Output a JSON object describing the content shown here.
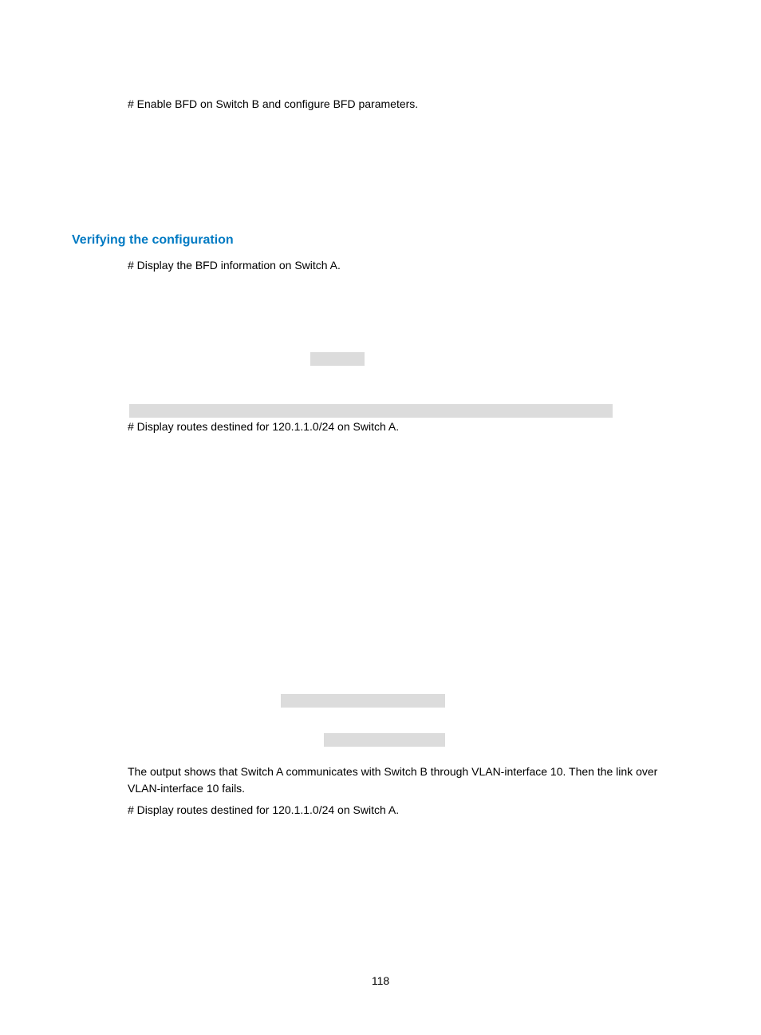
{
  "content": {
    "para1": "# Enable BFD on Switch B and configure BFD parameters.",
    "heading": "Verifying the configuration",
    "para2": "# Display the BFD information on Switch A.",
    "para3": "# Display routes destined for 120.1.1.0/24 on Switch A.",
    "para4": "The output shows that Switch A communicates with Switch B through VLAN-interface 10. Then the link over VLAN-interface 10 fails.",
    "para5": "# Display routes destined for 120.1.1.0/24 on Switch A."
  },
  "pageNumber": "118"
}
